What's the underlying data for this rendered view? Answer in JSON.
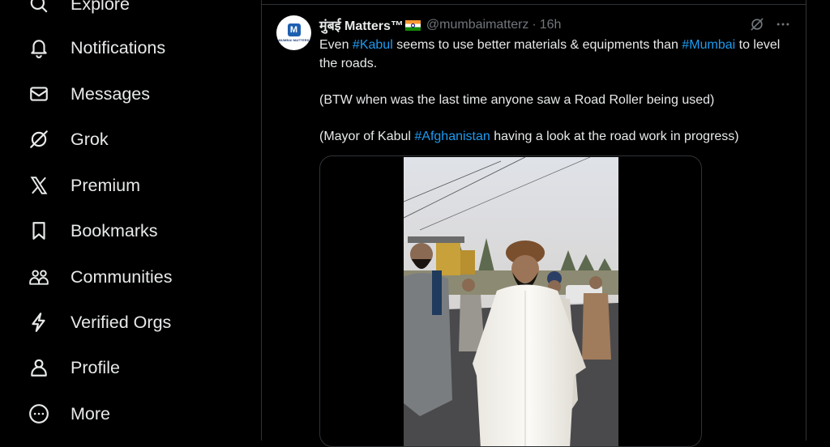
{
  "sidebar": {
    "items": [
      {
        "label": "Explore",
        "icon": "search-icon"
      },
      {
        "label": "Notifications",
        "icon": "bell-icon"
      },
      {
        "label": "Messages",
        "icon": "envelope-icon"
      },
      {
        "label": "Grok",
        "icon": "grok-icon"
      },
      {
        "label": "Premium",
        "icon": "x-logo-icon"
      },
      {
        "label": "Bookmarks",
        "icon": "bookmark-icon"
      },
      {
        "label": "Communities",
        "icon": "people-icon"
      },
      {
        "label": "Verified Orgs",
        "icon": "lightning-icon"
      },
      {
        "label": "Profile",
        "icon": "person-icon"
      },
      {
        "label": "More",
        "icon": "more-circle-icon"
      }
    ]
  },
  "tweet": {
    "avatar_text": "MUMBAI MATTERS",
    "avatar_letter": "M",
    "display_name": "मुंबई Matters™",
    "handle": "@mumbaimatterz",
    "separator": "·",
    "time": "16h",
    "body": {
      "line1_pre": "Even ",
      "tag_kabul": "#Kabul",
      "line1_mid": " seems to use better materials & equipments than ",
      "tag_mumbai": "#Mumbai",
      "line1_post": " to level the roads.",
      "para2": "(BTW when was the last time anyone saw a Road Roller being used)",
      "para3_pre": "(Mayor of Kabul ",
      "tag_afghanistan": "#Afghanistan",
      "para3_post": " having a look at the road work in progress)"
    }
  },
  "colors": {
    "background": "#000000",
    "text": "#e7e9ea",
    "muted": "#71767b",
    "link": "#1d9bf0",
    "border": "#2f3336"
  }
}
